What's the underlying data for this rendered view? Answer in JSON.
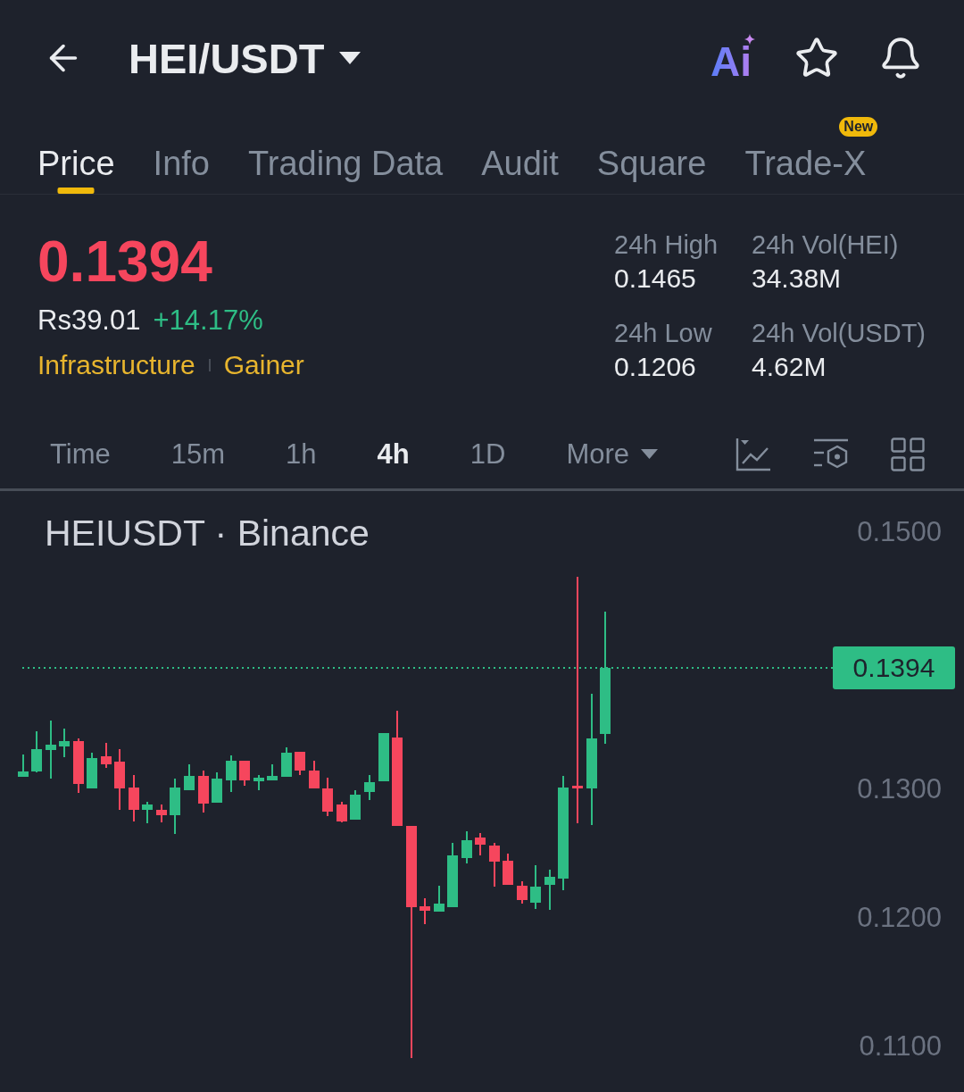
{
  "header": {
    "title": "HEI/USDT",
    "ai_label": "Ai"
  },
  "tabs": [
    {
      "label": "Price",
      "selected": true
    },
    {
      "label": "Info",
      "selected": false
    },
    {
      "label": "Trading Data",
      "selected": false
    },
    {
      "label": "Audit",
      "selected": false
    },
    {
      "label": "Square",
      "selected": false
    },
    {
      "label": "Trade-X",
      "selected": false,
      "badge": "New"
    }
  ],
  "ticker": {
    "price": "0.1394",
    "fiat_price": "Rs39.01",
    "change": "+14.17%",
    "tags": [
      "Infrastructure",
      "Gainer"
    ]
  },
  "stats": [
    {
      "label": "24h High",
      "value": "0.1465"
    },
    {
      "label": "24h Vol(HEI)",
      "value": "34.38M"
    },
    {
      "label": "24h Low",
      "value": "0.1206"
    },
    {
      "label": "24h Vol(USDT)",
      "value": "4.62M"
    }
  ],
  "intervals": [
    {
      "label": "Time",
      "selected": false
    },
    {
      "label": "15m",
      "selected": false
    },
    {
      "label": "1h",
      "selected": false
    },
    {
      "label": "4h",
      "selected": true
    },
    {
      "label": "1D",
      "selected": false
    }
  ],
  "more_menu": {
    "label": "More"
  },
  "chart": {
    "title": "HEIUSDT · Binance",
    "axis_labels": [
      "0.1500",
      "0.1300",
      "0.1200",
      "0.1100"
    ],
    "last_price": "0.1394"
  }
}
